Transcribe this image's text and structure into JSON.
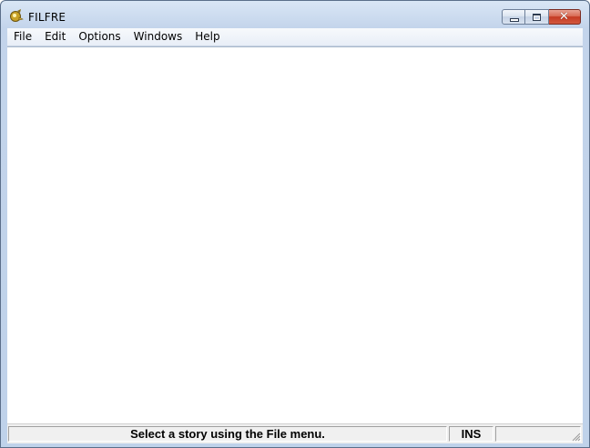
{
  "window": {
    "title": "FILFRE",
    "close_glyph": "✕"
  },
  "menu": {
    "items": [
      "File",
      "Edit",
      "Options",
      "Windows",
      "Help"
    ]
  },
  "status": {
    "message": "Select a story using the File menu.",
    "mode": "INS",
    "extra": ""
  },
  "icons": {
    "app": "filfre-app-icon",
    "minimize": "minimize-icon",
    "maximize": "maximize-icon",
    "close": "close-icon",
    "grip": "resize-grip-icon"
  },
  "colors": {
    "frame": "#bfd2ea",
    "close_button": "#c43a22",
    "client": "#ffffff",
    "statusbar": "#f0f0f0"
  }
}
